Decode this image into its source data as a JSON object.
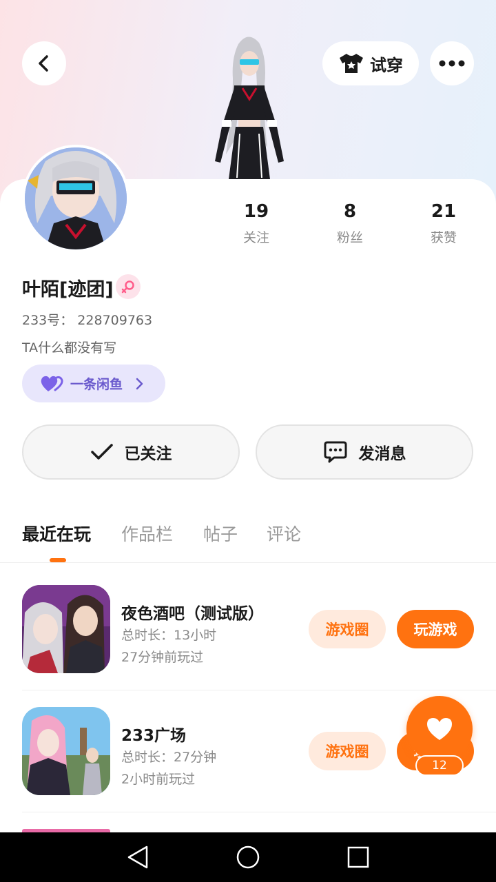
{
  "header": {
    "tryon_label": "试穿"
  },
  "profile": {
    "username": "叶陌[迹团]",
    "uid": "233号： 228709763",
    "bio": "TA什么都没有写",
    "group_name": "一条闲鱼"
  },
  "stats": [
    {
      "value": "19",
      "label": "关注"
    },
    {
      "value": "8",
      "label": "粉丝"
    },
    {
      "value": "21",
      "label": "获赞"
    }
  ],
  "actions": {
    "follow_label": "已关注",
    "message_label": "发消息"
  },
  "tabs": [
    {
      "label": "最近在玩",
      "active": true
    },
    {
      "label": "作品栏",
      "active": false
    },
    {
      "label": "帖子",
      "active": false
    },
    {
      "label": "评论",
      "active": false
    }
  ],
  "games": [
    {
      "title": "夜色酒吧（测试版）",
      "duration": "总时长：13小时",
      "last_played": "27分钟前玩过",
      "circle_label": "游戏圈",
      "play_label": "玩游戏"
    },
    {
      "title": "233广场",
      "duration": "总时长：27分钟",
      "last_played": "2小时前玩过",
      "circle_label": "游戏圈",
      "play_label": "玩游戏"
    }
  ],
  "floating_like": {
    "count": "12"
  },
  "icons": {
    "back": "chevron-left-icon",
    "tryon": "shirt-icon",
    "more": "more-dots-icon",
    "gender": "female-icon",
    "group": "heart-pair-icon",
    "follow": "check-icon",
    "message": "chat-bubble-icon",
    "like": "heart-icon"
  },
  "colors": {
    "accent": "#ff7210",
    "accent_light": "#ffeadd",
    "group_pill_bg": "#e8e6fc",
    "group_pill_text": "#6a5acd"
  }
}
